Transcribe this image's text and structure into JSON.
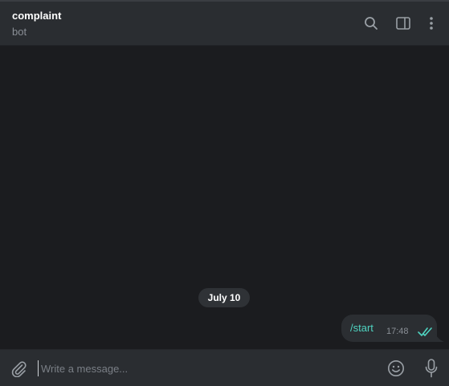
{
  "header": {
    "title": "complaint",
    "status": "bot",
    "icons": [
      "search-icon",
      "sidebar-toggle-icon",
      "more-vertical-icon"
    ]
  },
  "messages": {
    "date_separator": "July 10",
    "items": [
      {
        "text": "/start",
        "time": "17:48",
        "status_icon": "double-check-icon",
        "outgoing": true
      }
    ]
  },
  "composer": {
    "placeholder": "Write a message...",
    "value": "",
    "icons": [
      "paperclip-icon",
      "emoji-icon",
      "microphone-icon"
    ]
  },
  "colors": {
    "background": "#1b1c1f",
    "header_bg": "#2a2d31",
    "bubble_bg": "#2b2e32",
    "accent": "#4fd3c0",
    "muted_text": "#8a8f96"
  }
}
